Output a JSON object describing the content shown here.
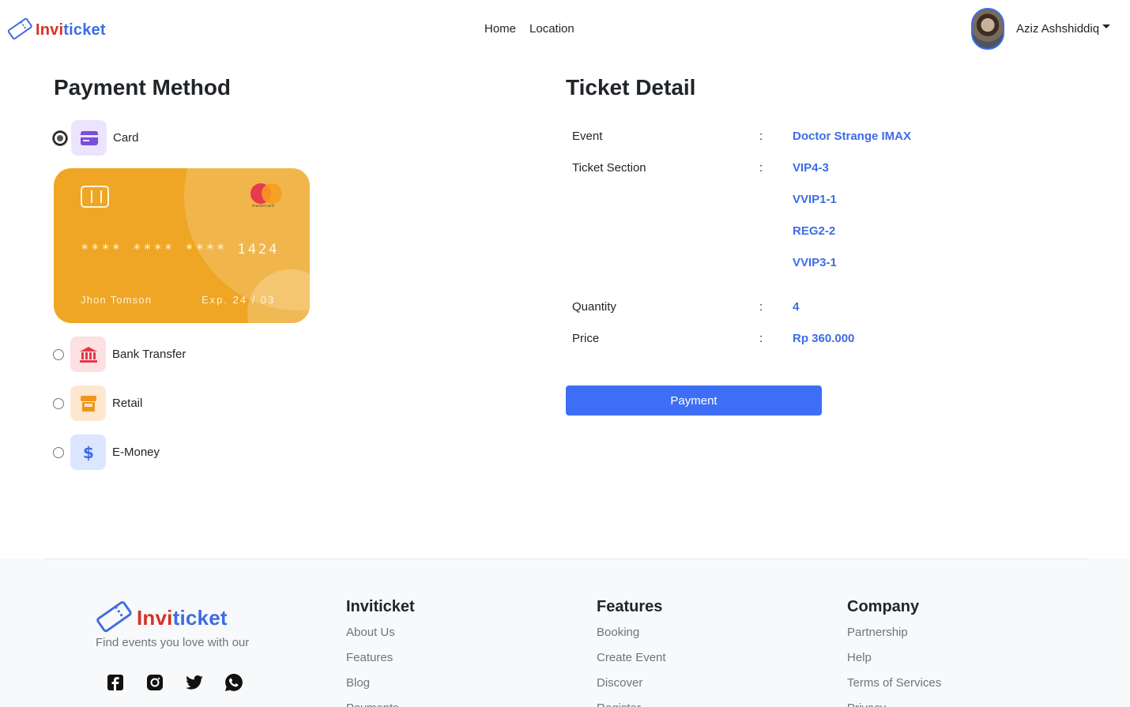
{
  "navbar": {
    "brand_part1": "Invi",
    "brand_part2": "ticket",
    "links": [
      "Home",
      "Location"
    ],
    "user_name": "Aziz Ashshiddiq"
  },
  "payment": {
    "title": "Payment Method",
    "options": [
      {
        "label": "Card",
        "icon": "credit-card-icon",
        "selected": true
      },
      {
        "label": "Bank Transfer",
        "icon": "bank-icon",
        "selected": false
      },
      {
        "label": "Retail",
        "icon": "store-icon",
        "selected": false
      },
      {
        "label": "E-Money",
        "icon": "dollar-icon",
        "selected": false
      }
    ],
    "card": {
      "number": "****  ****  ****  1424",
      "holder": "Jhon Tomson",
      "expiry": "Exp. 24 / 03",
      "network": "mastercard"
    }
  },
  "ticket": {
    "title": "Ticket Detail",
    "event_label": "Event",
    "event_value": "Doctor Strange IMAX",
    "section_label": "Ticket Section",
    "sections": [
      "VIP4-3",
      "VVIP1-1",
      "REG2-2",
      "VVIP3-1"
    ],
    "quantity_label": "Quantity",
    "quantity_value": "4",
    "price_label": "Price",
    "price_value": "Rp 360.000",
    "colon": ":",
    "button": "Payment"
  },
  "footer": {
    "brand_part1": "Invi",
    "brand_part2": "ticket",
    "tagline": "Find events you love with our",
    "columns": [
      {
        "title": "Inviticket",
        "links": [
          "About Us",
          "Features",
          "Blog",
          "Payments"
        ]
      },
      {
        "title": "Features",
        "links": [
          "Booking",
          "Create Event",
          "Discover",
          "Register"
        ]
      },
      {
        "title": "Company",
        "links": [
          "Partnership",
          "Help",
          "Terms of Services",
          "Privacy"
        ]
      }
    ]
  },
  "colors": {
    "accent": "#3d6ce5",
    "brand_red": "#d93025",
    "card": "#eea624",
    "button": "#3d6ef5"
  }
}
